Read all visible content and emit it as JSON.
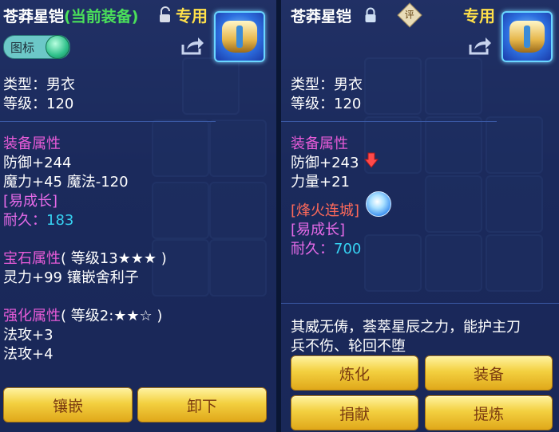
{
  "left_panel": {
    "title": "苍莽星铠",
    "equip_status": "(当前装备)",
    "exclusive_tag": "专用",
    "icon_toggle_label": "图标",
    "type_line": "类型：男衣",
    "level_line": "等级：120",
    "equip_attr_heading": "装备属性",
    "defense": "防御+244",
    "magic_power": "魔力+45 魔法-120",
    "special": "[易成长]",
    "durability_label": "耐久：",
    "durability_value": "183",
    "gem_heading": "宝石属性",
    "gem_level": "( 等级13★★★ )",
    "gem_effect": "灵力+99 镶嵌舍利子",
    "enhance_heading": "强化属性",
    "enhance_level": "( 等级2:★★☆ )",
    "enhance_1": "法攻+3",
    "enhance_2": "法攻+4",
    "btn_inlay": "镶嵌",
    "btn_unequip": "卸下"
  },
  "right_panel": {
    "title": "苍莽星铠",
    "eval_badge": "评",
    "exclusive_tag": "专用",
    "type_line": "类型：男衣",
    "level_line": "等级：120",
    "equip_attr_heading": "装备属性",
    "defense": "防御+243",
    "strength": "力量+21",
    "special_skill": "[烽火连城]",
    "special": "[易成长]",
    "durability_label": "耐久：",
    "durability_value": "700",
    "description_1": "其威无俦，荟萃星辰之力，能护主刀",
    "description_2": "兵不伤、轮回不堕",
    "btn_refine": "炼化",
    "btn_equip": "装备",
    "btn_donate": "捐献",
    "btn_extract": "提炼"
  },
  "colors": {
    "panel_bg": "#1d2f66",
    "section_heading": "#e75bd8",
    "green": "#4be05a",
    "yellow": "#ffe04a",
    "cyan": "#36d2f2",
    "button": "#f3d040"
  }
}
